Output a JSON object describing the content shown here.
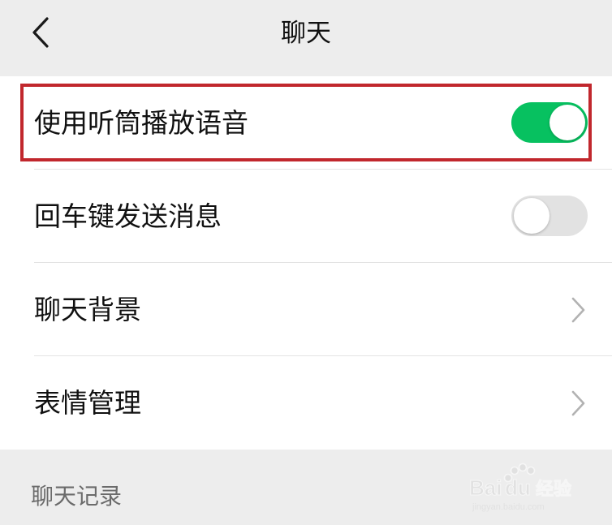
{
  "nav": {
    "title": "聊天",
    "back_icon": "chevron-left-icon"
  },
  "settings": {
    "items": [
      {
        "label": "使用听筒播放语音",
        "control": "toggle",
        "enabled": true
      },
      {
        "label": "回车键发送消息",
        "control": "toggle",
        "enabled": false
      },
      {
        "label": "聊天背景",
        "control": "chevron",
        "icon": "chevron-right-icon"
      },
      {
        "label": "表情管理",
        "control": "chevron",
        "icon": "chevron-right-icon"
      }
    ]
  },
  "section": {
    "chat_history_header": "聊天记录"
  },
  "annotation": {
    "highlight_color": "#c1272d"
  },
  "colors": {
    "toggle_on": "#07c160",
    "toggle_off": "#e2e2e2",
    "background": "#ededed"
  },
  "watermark": {
    "logo_text": "Baidu 经验",
    "url_text": "jingyan.baidu.com"
  }
}
